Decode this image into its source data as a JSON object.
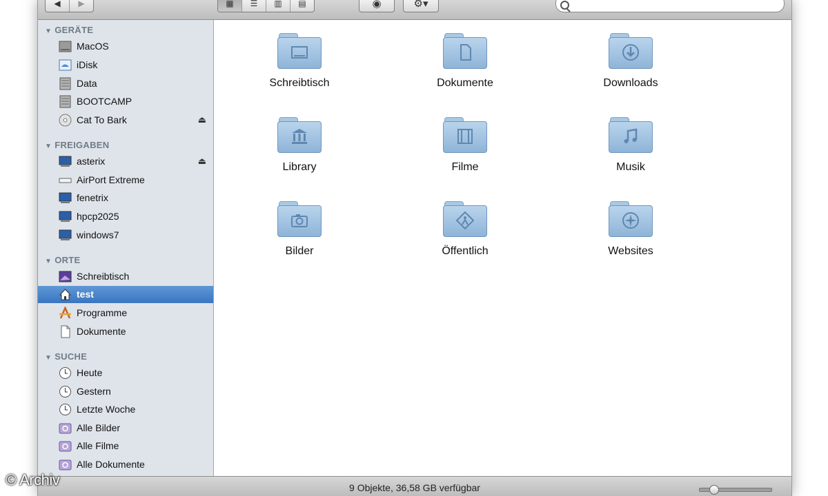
{
  "toolbar": {
    "nav": {
      "back_icon": "arrow-left-icon",
      "forward_icon": "arrow-right-icon"
    },
    "views": [
      "icon-view-icon",
      "list-view-icon",
      "column-view-icon",
      "coverflow-view-icon"
    ],
    "quicklook_icon": "eye-icon",
    "action_icon": "gear-icon",
    "search_placeholder": ""
  },
  "sidebar": {
    "sections": [
      {
        "title": "GERÄTE",
        "items": [
          {
            "label": "MacOS",
            "icon": "hard-drive-icon"
          },
          {
            "label": "iDisk",
            "icon": "idisk-icon"
          },
          {
            "label": "Data",
            "icon": "hard-drive-icon"
          },
          {
            "label": "BOOTCAMP",
            "icon": "hard-drive-icon"
          },
          {
            "label": "Cat To Bark",
            "icon": "cd-icon",
            "eject": true
          }
        ]
      },
      {
        "title": "FREIGABEN",
        "items": [
          {
            "label": "asterix",
            "icon": "computer-icon",
            "eject": true
          },
          {
            "label": "AirPort Extreme",
            "icon": "airport-icon"
          },
          {
            "label": "fenetrix",
            "icon": "computer-icon"
          },
          {
            "label": "hpcp2025",
            "icon": "computer-icon"
          },
          {
            "label": "windows7",
            "icon": "computer-icon"
          }
        ]
      },
      {
        "title": "ORTE",
        "items": [
          {
            "label": "Schreibtisch",
            "icon": "desktop-icon"
          },
          {
            "label": "test",
            "icon": "home-icon",
            "selected": true
          },
          {
            "label": "Programme",
            "icon": "applications-icon"
          },
          {
            "label": "Dokumente",
            "icon": "document-icon"
          }
        ]
      },
      {
        "title": "SUCHE",
        "items": [
          {
            "label": "Heute",
            "icon": "clock-icon"
          },
          {
            "label": "Gestern",
            "icon": "clock-icon"
          },
          {
            "label": "Letzte Woche",
            "icon": "clock-icon"
          },
          {
            "label": "Alle Bilder",
            "icon": "smart-folder-icon"
          },
          {
            "label": "Alle Filme",
            "icon": "smart-folder-icon"
          },
          {
            "label": "Alle Dokumente",
            "icon": "smart-folder-icon"
          }
        ]
      }
    ]
  },
  "content": {
    "items": [
      {
        "label": "Schreibtisch",
        "icon": "desktop-folder-icon"
      },
      {
        "label": "Dokumente",
        "icon": "documents-folder-icon"
      },
      {
        "label": "Downloads",
        "icon": "downloads-folder-icon"
      },
      {
        "label": "Library",
        "icon": "library-folder-icon"
      },
      {
        "label": "Filme",
        "icon": "movies-folder-icon"
      },
      {
        "label": "Musik",
        "icon": "music-folder-icon"
      },
      {
        "label": "Bilder",
        "icon": "pictures-folder-icon"
      },
      {
        "label": "Öffentlich",
        "icon": "public-folder-icon"
      },
      {
        "label": "Websites",
        "icon": "sites-folder-icon"
      }
    ]
  },
  "statusbar": {
    "text": "9 Objekte, 36,58 GB verfügbar",
    "zoom_level": 0.15
  },
  "watermark": "© Archiv"
}
